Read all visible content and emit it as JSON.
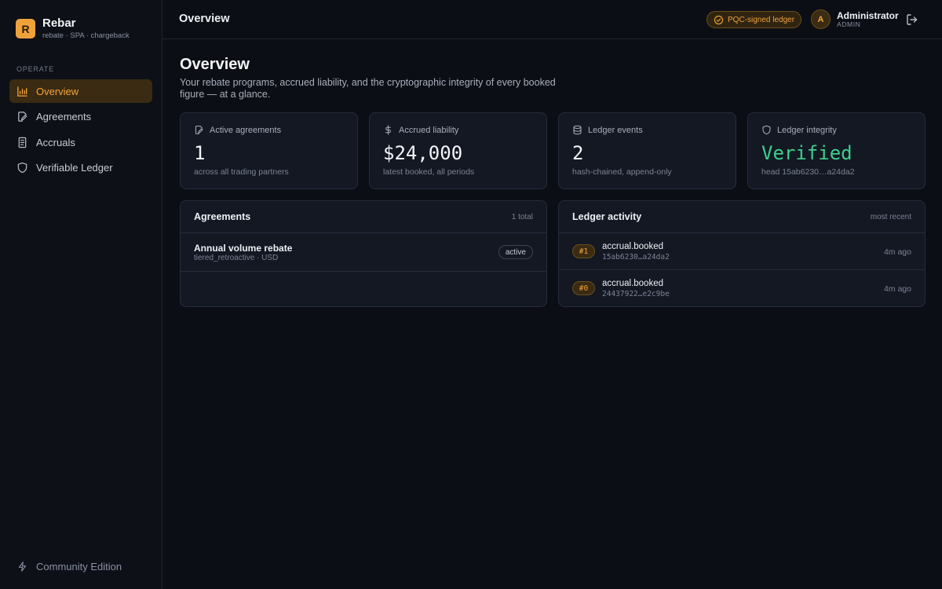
{
  "brand": {
    "logo_letter": "R",
    "name": "Rebar",
    "subtitle": "rebate · SPA · chargeback"
  },
  "sidebar": {
    "section_label": "OPERATE",
    "items": [
      {
        "label": "Overview",
        "icon": "bar-chart-icon",
        "active": true
      },
      {
        "label": "Agreements",
        "icon": "file-signature-icon",
        "active": false
      },
      {
        "label": "Accruals",
        "icon": "receipt-icon",
        "active": false
      },
      {
        "label": "Verifiable Ledger",
        "icon": "shield-icon",
        "active": false
      }
    ],
    "edition": "Community Edition"
  },
  "topbar": {
    "title": "Overview",
    "badge": "PQC-signed ledger",
    "user": {
      "initial": "A",
      "name": "Administrator",
      "role": "ADMIN"
    }
  },
  "page": {
    "title": "Overview",
    "description": "Your rebate programs, accrued liability, and the cryptographic integrity of every booked figure — at a glance."
  },
  "stats": [
    {
      "label": "Active agreements",
      "value": "1",
      "sub": "across all trading partners",
      "icon": "file-signature-icon"
    },
    {
      "label": "Accrued liability",
      "value": "$24,000",
      "sub": "latest booked, all periods",
      "icon": "dollar-icon"
    },
    {
      "label": "Ledger events",
      "value": "2",
      "sub": "hash-chained, append-only",
      "icon": "database-icon"
    },
    {
      "label": "Ledger integrity",
      "value": "Verified",
      "sub": "head 15ab6230…a24da2",
      "icon": "shield-icon"
    }
  ],
  "agreements": {
    "title": "Agreements",
    "meta": "1 total",
    "rows": [
      {
        "name": "Annual volume rebate",
        "meta": "tiered_retroactive · USD",
        "status": "active"
      }
    ]
  },
  "ledger": {
    "title": "Ledger activity",
    "meta": "most recent",
    "rows": [
      {
        "seq": "#1",
        "event": "accrual.booked",
        "hash": "15ab6230…a24da2",
        "time": "4m ago"
      },
      {
        "seq": "#0",
        "event": "accrual.booked",
        "hash": "24437922…e2c9be",
        "time": "4m ago"
      }
    ]
  },
  "colors": {
    "accent": "#f0a23a",
    "verified": "#3ecf8e",
    "background": "#0b0e14",
    "card": "#131823"
  }
}
